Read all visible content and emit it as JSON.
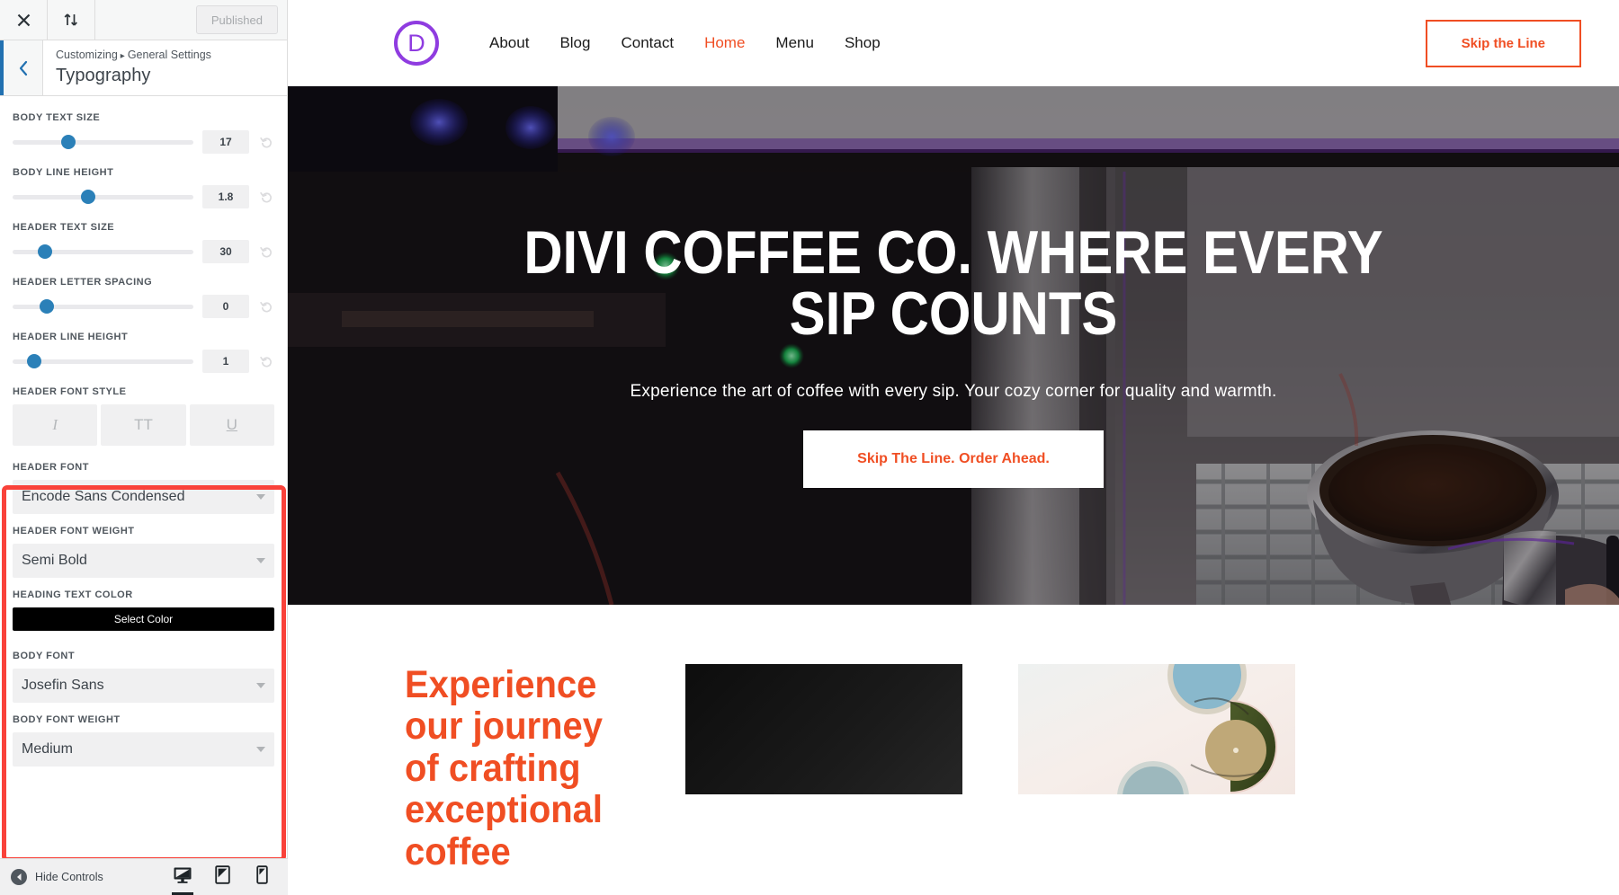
{
  "customizer": {
    "topbar": {
      "close_label": "×",
      "close_icon": "close-icon",
      "devices_icon": "arrows-updown-icon",
      "publish_label": "Published"
    },
    "header": {
      "back_icon": "chevron-left-icon",
      "breadcrumb_root": "Customizing",
      "breadcrumb_sep": "▸",
      "breadcrumb_section": "General Settings",
      "title": "Typography"
    },
    "sliders": [
      {
        "label": "BODY TEXT SIZE",
        "value": "17",
        "pos_pct": 31
      },
      {
        "label": "BODY LINE HEIGHT",
        "value": "1.8",
        "pos_pct": 42
      },
      {
        "label": "HEADER TEXT SIZE",
        "value": "30",
        "pos_pct": 18
      },
      {
        "label": "HEADER LETTER SPACING",
        "value": "0",
        "pos_pct": 19
      },
      {
        "label": "HEADER LINE HEIGHT",
        "value": "1",
        "pos_pct": 12
      }
    ],
    "font_style": {
      "label": "HEADER FONT STYLE",
      "buttons": [
        {
          "name": "italic-toggle",
          "glyph": "I"
        },
        {
          "name": "uppercase-toggle",
          "glyph": "TT"
        },
        {
          "name": "underline-toggle",
          "glyph": "U"
        }
      ]
    },
    "fields": {
      "header_font_label": "HEADER FONT",
      "header_font_value": "Encode Sans Condensed",
      "header_font_weight_label": "HEADER FONT WEIGHT",
      "header_font_weight_value": "Semi Bold",
      "heading_text_color_label": "HEADING TEXT COLOR",
      "heading_text_color_button": "Select Color",
      "heading_text_color_hex": "#000000",
      "body_font_label": "BODY FONT",
      "body_font_value": "Josefin Sans",
      "body_font_weight_label": "BODY FONT WEIGHT",
      "body_font_weight_value": "Medium"
    },
    "highlight_color": "#f9423a",
    "footer": {
      "hide_controls_label": "Hide Controls",
      "hide_controls_icon": "collapse-left-icon",
      "devices": [
        {
          "name": "desktop-preview-icon",
          "active": true
        },
        {
          "name": "tablet-preview-icon",
          "active": false
        },
        {
          "name": "mobile-preview-icon",
          "active": false
        }
      ]
    }
  },
  "site": {
    "logo": {
      "name": "divi-logo-icon",
      "letter": "D",
      "color": "#8f3ce0"
    },
    "nav": [
      {
        "label": "About",
        "active": false
      },
      {
        "label": "Blog",
        "active": false
      },
      {
        "label": "Contact",
        "active": false
      },
      {
        "label": "Home",
        "active": true
      },
      {
        "label": "Menu",
        "active": false
      },
      {
        "label": "Shop",
        "active": false
      }
    ],
    "nav_cta": "Skip the Line",
    "accent_color": "#f04e23",
    "hero": {
      "title": "DIVI COFFEE CO. WHERE EVERY SIP COUNTS",
      "subtitle": "Experience the art of coffee with every sip. Your cozy corner for quality and warmth.",
      "button": "Skip The Line. Order Ahead."
    },
    "lower": {
      "heading": "Experience our journey of crafting exceptional coffee",
      "images": [
        {
          "name": "dark-coffee-photo"
        },
        {
          "name": "ceramic-plates-photo"
        }
      ]
    }
  }
}
